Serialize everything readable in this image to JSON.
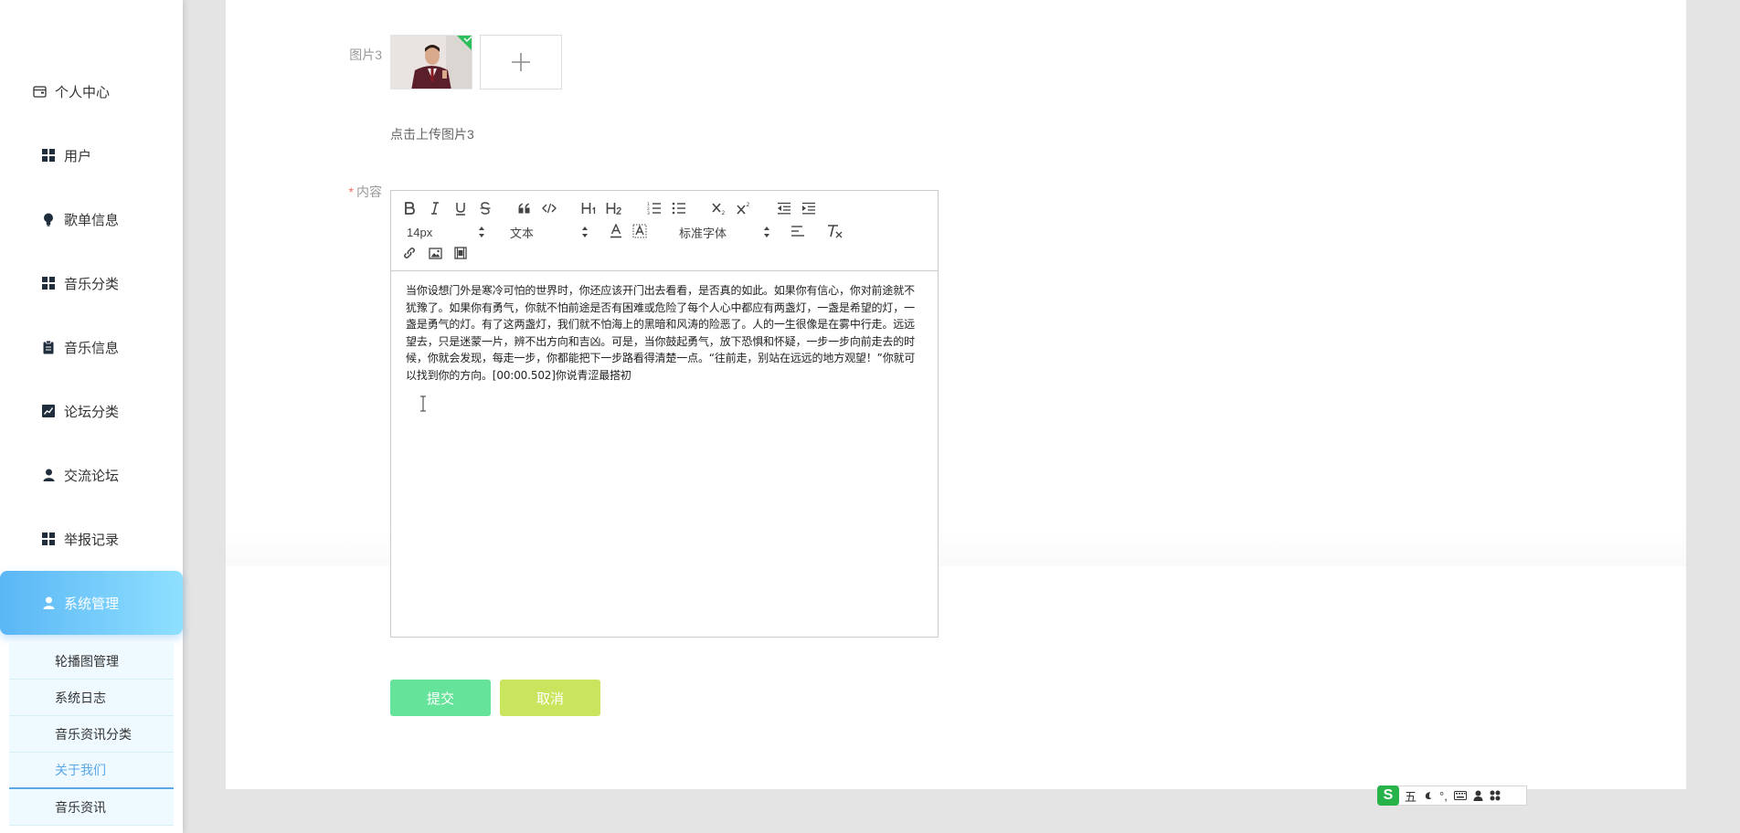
{
  "sidebar": {
    "personal_center": "个人中心",
    "items": [
      {
        "label": "用户",
        "icon": "grid-icon"
      },
      {
        "label": "歌单信息",
        "icon": "bulb-icon"
      },
      {
        "label": "音乐分类",
        "icon": "grid-icon"
      },
      {
        "label": "音乐信息",
        "icon": "clipboard-icon"
      },
      {
        "label": "论坛分类",
        "icon": "chart-icon"
      },
      {
        "label": "交流论坛",
        "icon": "user-icon"
      },
      {
        "label": "举报记录",
        "icon": "grid-icon"
      },
      {
        "label": "系统管理",
        "icon": "user-icon",
        "active": true
      }
    ],
    "sub_items": [
      {
        "label": "轮播图管理"
      },
      {
        "label": "系统日志"
      },
      {
        "label": "音乐资讯分类"
      },
      {
        "label": "关于我们",
        "active": true
      },
      {
        "label": "音乐资讯"
      }
    ]
  },
  "form": {
    "image3_label": "图片3",
    "upload_hint": "点击上传图片3",
    "content_label": "内容",
    "required_mark": "*",
    "upload_plus": "+"
  },
  "editor": {
    "size_select": "14px",
    "text_type_select": "文本",
    "font_select": "标准字体",
    "content": "当你设想门外是寒冷可怕的世界时，你还应该开门出去看看，是否真的如此。如果你有信心，你对前途就不犹豫了。如果你有勇气，你就不怕前途是否有困难或危险了每个人心中都应有两盏灯，一盏是希望的灯，一盏是勇气的灯。有了这两盏灯，我们就不怕海上的黑暗和风涛的险恶了。人的一生很像是在雾中行走。远远望去，只是迷蒙一片，辨不出方向和吉凶。可是，当你鼓起勇气，放下恐惧和怀疑，一步一步向前走去的时候，你就会发现，每走一步，你都能把下一步路看得清楚一点。“往前走，别站在远远的地方观望！”你就可以找到你的方向。[00:00.502]你说青涩最搭初"
  },
  "buttons": {
    "submit": "提交",
    "cancel": "取消"
  },
  "ime": {
    "logo": "S",
    "mode": "五",
    "punct": "°,"
  },
  "colors": {
    "active_gradient_start": "#5ab6f5",
    "active_gradient_end": "#8fe0ff",
    "submit": "#66e39a",
    "cancel": "#c9e55e",
    "sub_active": "#5aa8e8",
    "required": "#f56c6c"
  }
}
